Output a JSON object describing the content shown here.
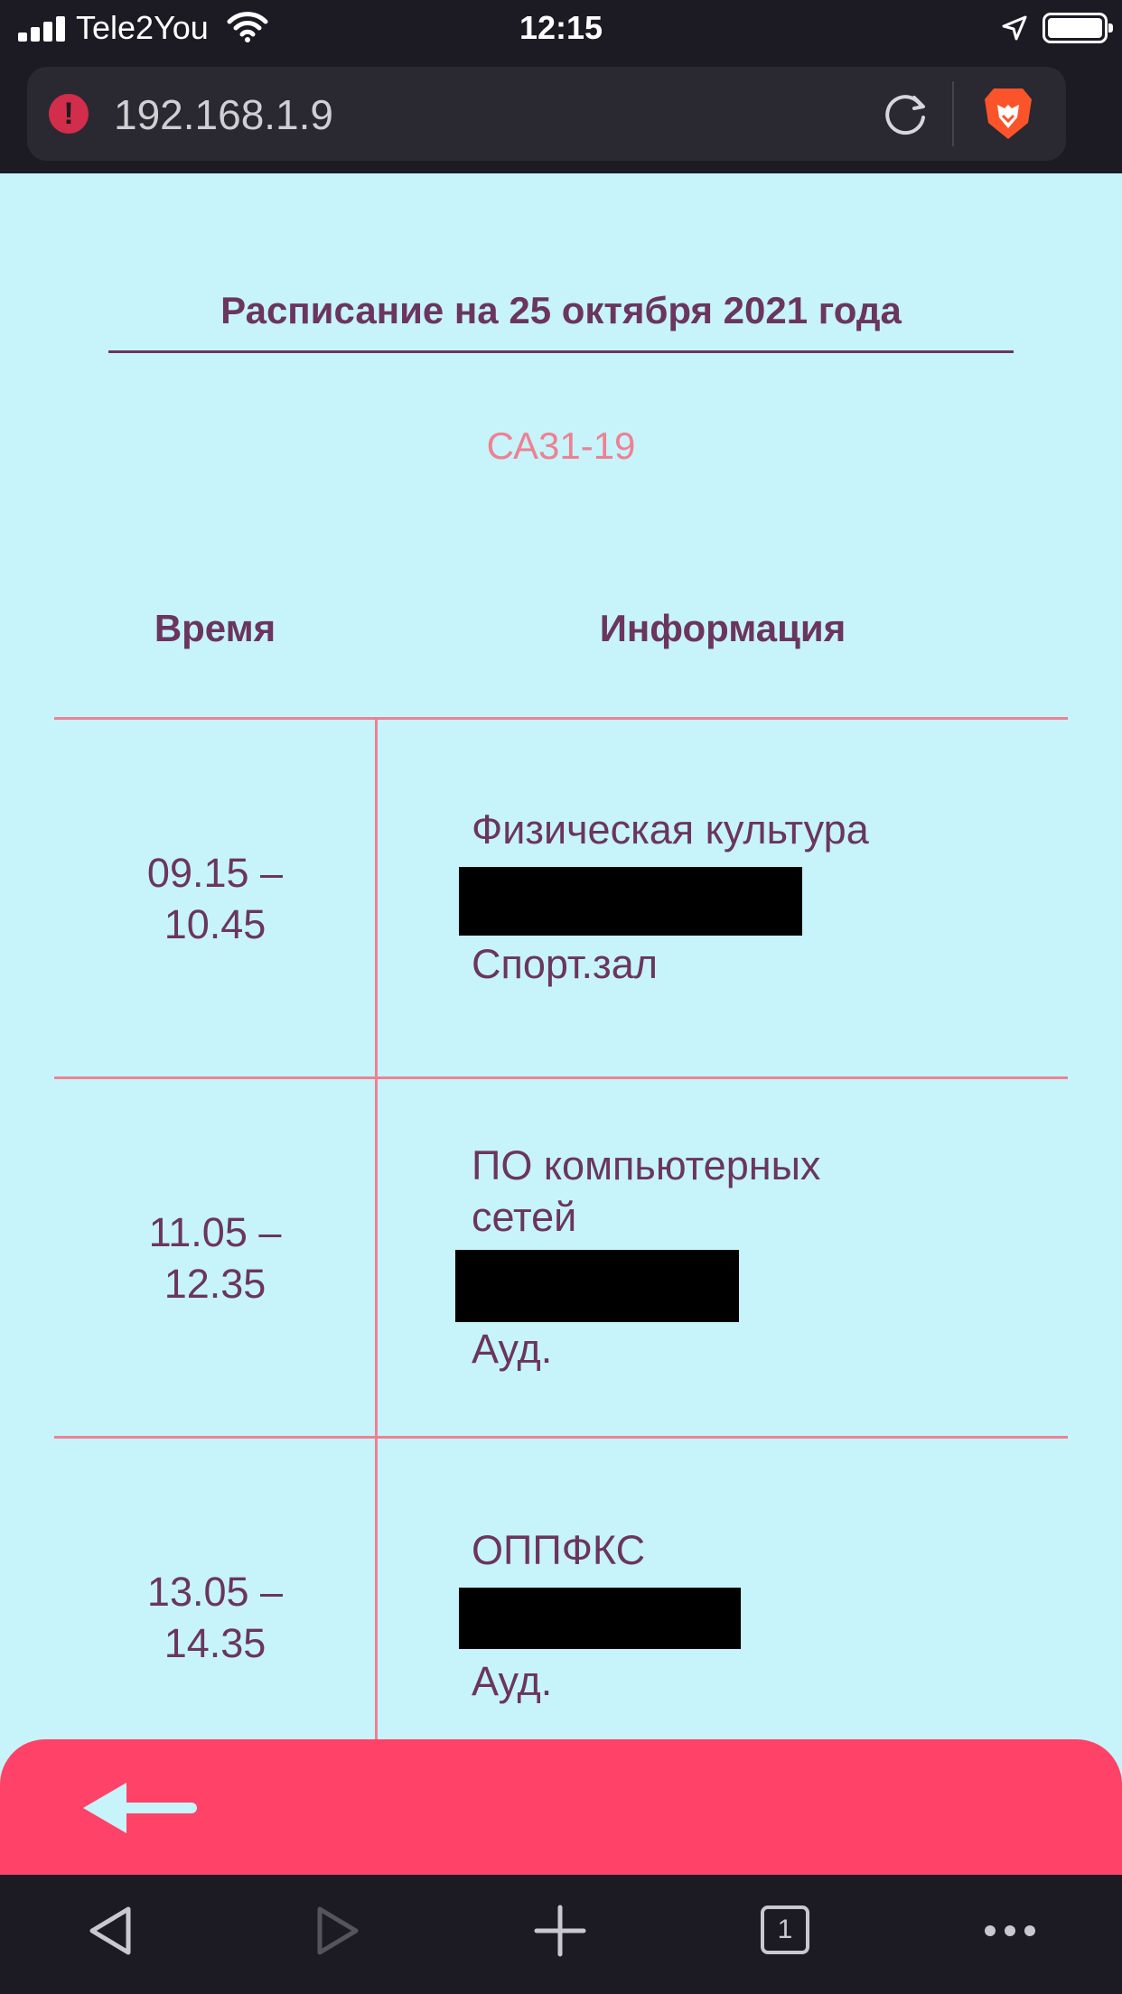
{
  "status_bar": {
    "carrier": "Tele2You",
    "time": "12:15"
  },
  "browser": {
    "url": "192.168.1.9",
    "tab_count": "1"
  },
  "page": {
    "title": "Расписание на 25 октября 2021 года",
    "group": "СА31-19",
    "columns": {
      "time": "Время",
      "info": "Информация"
    },
    "rows": [
      {
        "time_start": "09.15 –",
        "time_end": "10.45",
        "subject": "Физическая культура",
        "room": "Спорт.зал"
      },
      {
        "time_start": "11.05 –",
        "time_end": "12.35",
        "subject": "ПО компьютерных сетей",
        "room": "Ауд."
      },
      {
        "time_start": "13.05 –",
        "time_end": "14.35",
        "subject": "ОППФКС",
        "room": "Ауд."
      }
    ]
  },
  "colors": {
    "background": "#c6f4fa",
    "text": "#6b3560",
    "accent_pink": "#ef8093",
    "back_bar": "#fe4268",
    "chrome": "#1c1b24"
  },
  "icons": {
    "back": "arrow-left-icon",
    "nav_back": "triangle-left-icon",
    "nav_forward": "triangle-right-icon",
    "new_tab": "plus-icon",
    "menu": "more-dots-icon"
  }
}
